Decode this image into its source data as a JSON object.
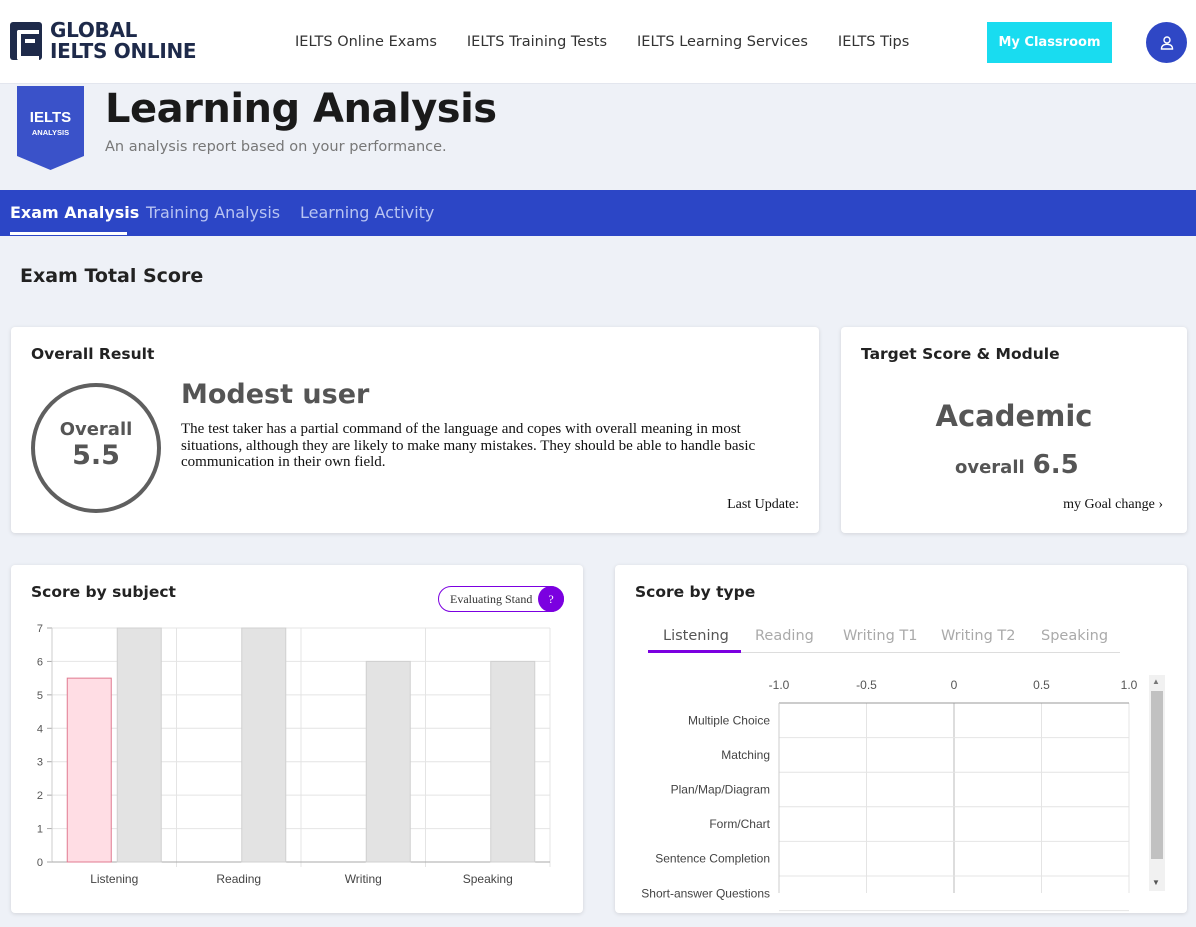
{
  "brand": {
    "line1": "GLOBAL",
    "line2": "IELTS ONLINE"
  },
  "nav": [
    "IELTS Online Exams",
    "IELTS Training Tests",
    "IELTS Learning Services",
    "IELTS Tips"
  ],
  "header": {
    "classroom_button": "My Classroom",
    "account_icon": "user-icon"
  },
  "page": {
    "badge_line1": "IELTS",
    "badge_line2": "ANALYSIS",
    "title": "Learning Analysis",
    "subtitle": "An analysis report based on your performance."
  },
  "tabs": [
    {
      "label": "Exam Analysis",
      "active": true
    },
    {
      "label": "Training Analysis",
      "active": false
    },
    {
      "label": "Learning Activity",
      "active": false
    }
  ],
  "section_title": "Exam Total Score",
  "overall_result": {
    "title": "Overall Result",
    "ring_label": "Overall",
    "score": "5.5",
    "level": "Modest user",
    "description": "The test taker has a partial command of the language and copes with overall meaning in most situations, although they are likely to make many mistakes. They should be able to handle basic communication in their own field.",
    "last_update": "Last Update:"
  },
  "target": {
    "title": "Target Score & Module",
    "module": "Academic",
    "overall_label": "overall",
    "overall_value": "6.5",
    "goal_link": "my Goal change ›"
  },
  "score_by_subject": {
    "title": "Score by subject",
    "evaluating_label": "Evaluating Stand",
    "help_icon": "?"
  },
  "score_by_type": {
    "title": "Score by type",
    "tabs": [
      "Listening",
      "Reading",
      "Writing T1",
      "Writing T2",
      "Speaking"
    ],
    "active_tab": 0
  },
  "colors": {
    "primary": "#2c46c6",
    "cyan": "#19dcf0",
    "purple": "#7b00e0",
    "score_bar": "#ffdde4",
    "target_bar": "#e3e3e3"
  },
  "chart_data": [
    {
      "type": "bar",
      "title": "Score by subject",
      "categories": [
        "Listening",
        "Reading",
        "Writing",
        "Speaking"
      ],
      "series": [
        {
          "values": [
            5.5,
            null,
            null,
            null
          ],
          "color": "#ffdde4"
        },
        {
          "values": [
            7,
            7,
            6,
            6
          ],
          "color": "#e3e3e3"
        }
      ],
      "ylim": [
        0,
        7
      ],
      "yticks": [
        "0",
        "1",
        "2",
        "3",
        "4",
        "5",
        "6",
        "7"
      ],
      "grid": true
    },
    {
      "type": "bar",
      "orientation": "horizontal",
      "title": "Score by type",
      "categories": [
        "Multiple Choice",
        "Matching",
        "Plan/Map/Diagram",
        "Form/Chart",
        "Sentence Completion",
        "Short-answer Questions"
      ],
      "values": [],
      "xlim": [
        -1.0,
        1.0
      ],
      "xticks": [
        "-1.0",
        "-0.5",
        "0",
        "0.5",
        "1.0"
      ],
      "grid": true
    }
  ]
}
